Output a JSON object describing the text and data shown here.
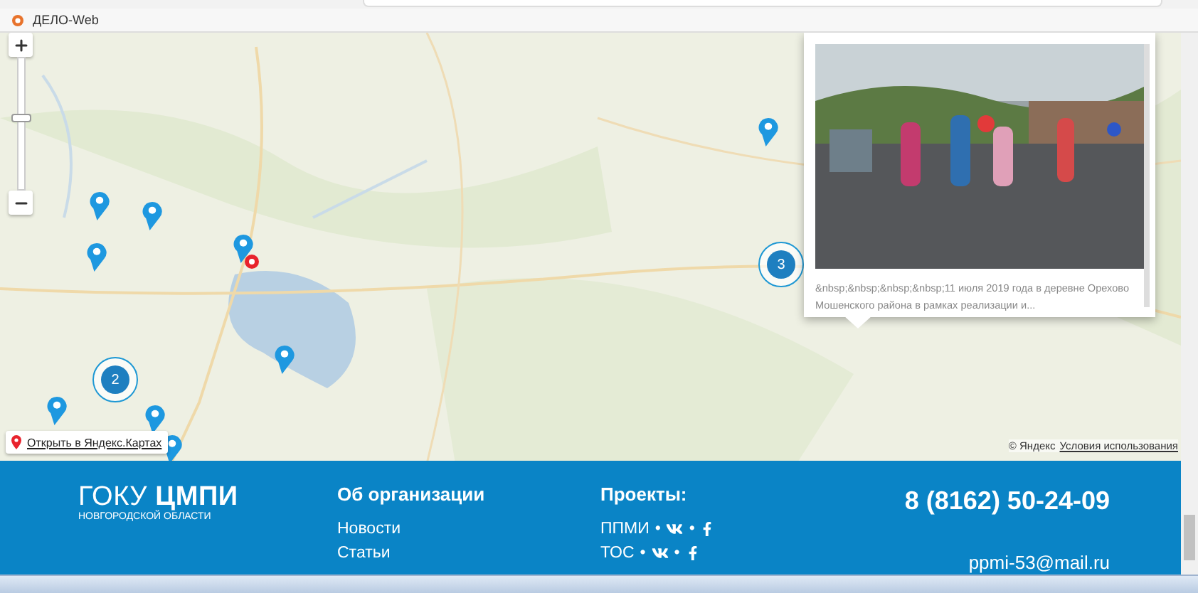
{
  "zoom": {
    "level": 0.55
  },
  "browser": {
    "bookmarks": [
      {
        "label": "ДЕЛО-Web"
      }
    ]
  },
  "map": {
    "clusters": [
      {
        "count": "2"
      },
      {
        "count": "3"
      }
    ],
    "balloon": {
      "caption": "&nbsp;&nbsp;&nbsp;&nbsp;11 июля 2019 года в деревне Орехово Мошенского района в рамках реализации и..."
    },
    "open_link": "Открыть в Яндекс.Картах",
    "copyright": "© Яндекс",
    "terms_link": "Условия использования"
  },
  "footer": {
    "logo": "ГОКУ **ЦМПИ**",
    "logo_sub": "НОВГОРОДСКОЙ ОБЛАСТИ",
    "about": {
      "title": "Об организации",
      "links": [
        "Новости",
        "Статьи"
      ]
    },
    "projects": {
      "title": "Проекты:",
      "rows": [
        {
          "label": "ППМИ",
          "separators": [
            "•",
            "•"
          ],
          "socials": [
            {
              "kind": "vk"
            },
            {
              "kind": "facebook"
            }
          ]
        },
        {
          "label": "ТОС",
          "separators": [
            "•",
            "•"
          ],
          "socials": [
            {
              "kind": "vk"
            },
            {
              "kind": "facebook"
            }
          ]
        }
      ]
    },
    "phone": "8 (8162) 50-24-09",
    "email": "ppmi-53@mail.ru"
  }
}
